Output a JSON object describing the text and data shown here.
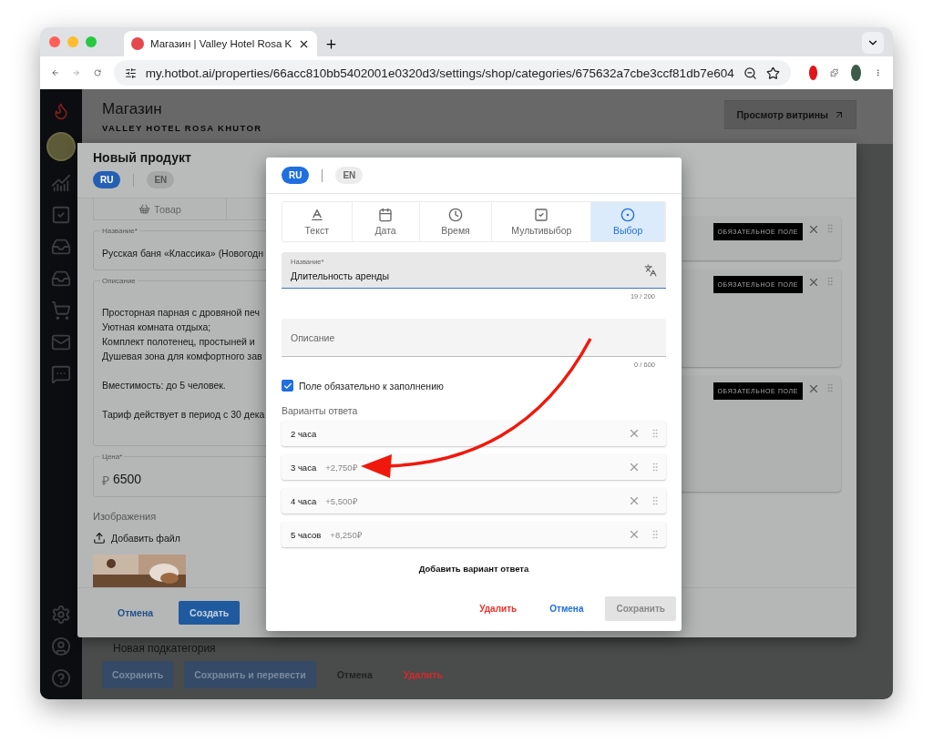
{
  "browser": {
    "tab_title": "Магазин | Valley Hotel Rosa K",
    "url": "my.hotbot.ai/properties/66acc810bb5402001e0320d3/settings/shop/categories/675632a7cbe3ccf81db7e604"
  },
  "page": {
    "title": "Магазин",
    "subtitle": "VALLEY HOTEL ROSA KHUTOR",
    "storefront_button": "Просмотр витрины",
    "subcategory": "Новая подкатегория",
    "actions": [
      {
        "label": "Сохранить",
        "kind": "primary"
      },
      {
        "label": "Сохранить и перевести",
        "kind": "primary"
      },
      {
        "label": "Отмена",
        "kind": "plain"
      },
      {
        "label": "Удалить",
        "kind": "danger"
      }
    ]
  },
  "product_modal": {
    "title": "Новый продукт",
    "languages": [
      {
        "label": "RU",
        "selected": true
      },
      {
        "label": "EN",
        "selected": false
      }
    ],
    "type_tab": "Товар",
    "name_label": "Название*",
    "name_value": "Русская баня «Классика» (Новогодн",
    "description_label": "Описание",
    "description_paragraphs": [
      [
        "Просторная парная с дровяной печ",
        "Уютная комната отдыха;",
        "Комплект полотенец, простыней и",
        "Душевая зона для комфортного зав"
      ],
      [
        "Вместимость: до 5 человек."
      ],
      [
        "Тариф действует в период с 30 дека"
      ]
    ],
    "price_label": "Цена*",
    "currency": "₽",
    "price": "6500",
    "images_label": "Изображения",
    "add_file": "Добавить файл",
    "field_cards": [
      {
        "badge": "ОБЯЗАТЕЛЬНОЕ ПОЛЕ"
      },
      {
        "badge": "ОБЯЗАТЕЛЬНОЕ ПОЛЕ"
      },
      {
        "badge": "ОБЯЗАТЕЛЬНОЕ ПОЛЕ"
      }
    ],
    "buttons": [
      {
        "label": "Отмена",
        "kind": "text"
      },
      {
        "label": "Создать",
        "kind": "primary"
      }
    ]
  },
  "dialog": {
    "languages": [
      {
        "label": "RU",
        "selected": true
      },
      {
        "label": "EN",
        "selected": false
      }
    ],
    "field_types": [
      {
        "label": "Текст",
        "kind": "text",
        "selected": false
      },
      {
        "label": "Дата",
        "kind": "date",
        "selected": false
      },
      {
        "label": "Время",
        "kind": "time",
        "selected": false
      },
      {
        "label": "Мультивыбор",
        "kind": "multi",
        "selected": false
      },
      {
        "label": "Выбор",
        "kind": "single",
        "selected": true
      }
    ],
    "name_label": "Название*",
    "name_value": "Длительность аренды",
    "name_counter": "19 / 200",
    "description_placeholder": "Описание",
    "description_counter": "0 / 600",
    "required": {
      "label": "Поле обязательно к заполнению",
      "checked": true
    },
    "options_label": "Варианты ответа",
    "options": [
      {
        "label": "2 часа"
      },
      {
        "label": "3 часа",
        "price": "+2,750₽"
      },
      {
        "label": "4 часа",
        "price": "+5,500₽"
      },
      {
        "label": "5 часов",
        "price": "+8,250₽"
      }
    ],
    "add_option": "Добавить вариант ответа",
    "buttons": [
      {
        "label": "Удалить",
        "kind": "danger",
        "disabled": false
      },
      {
        "label": "Отмена",
        "kind": "text",
        "disabled": false
      },
      {
        "label": "Сохранить",
        "kind": "primary",
        "disabled": true
      }
    ]
  }
}
